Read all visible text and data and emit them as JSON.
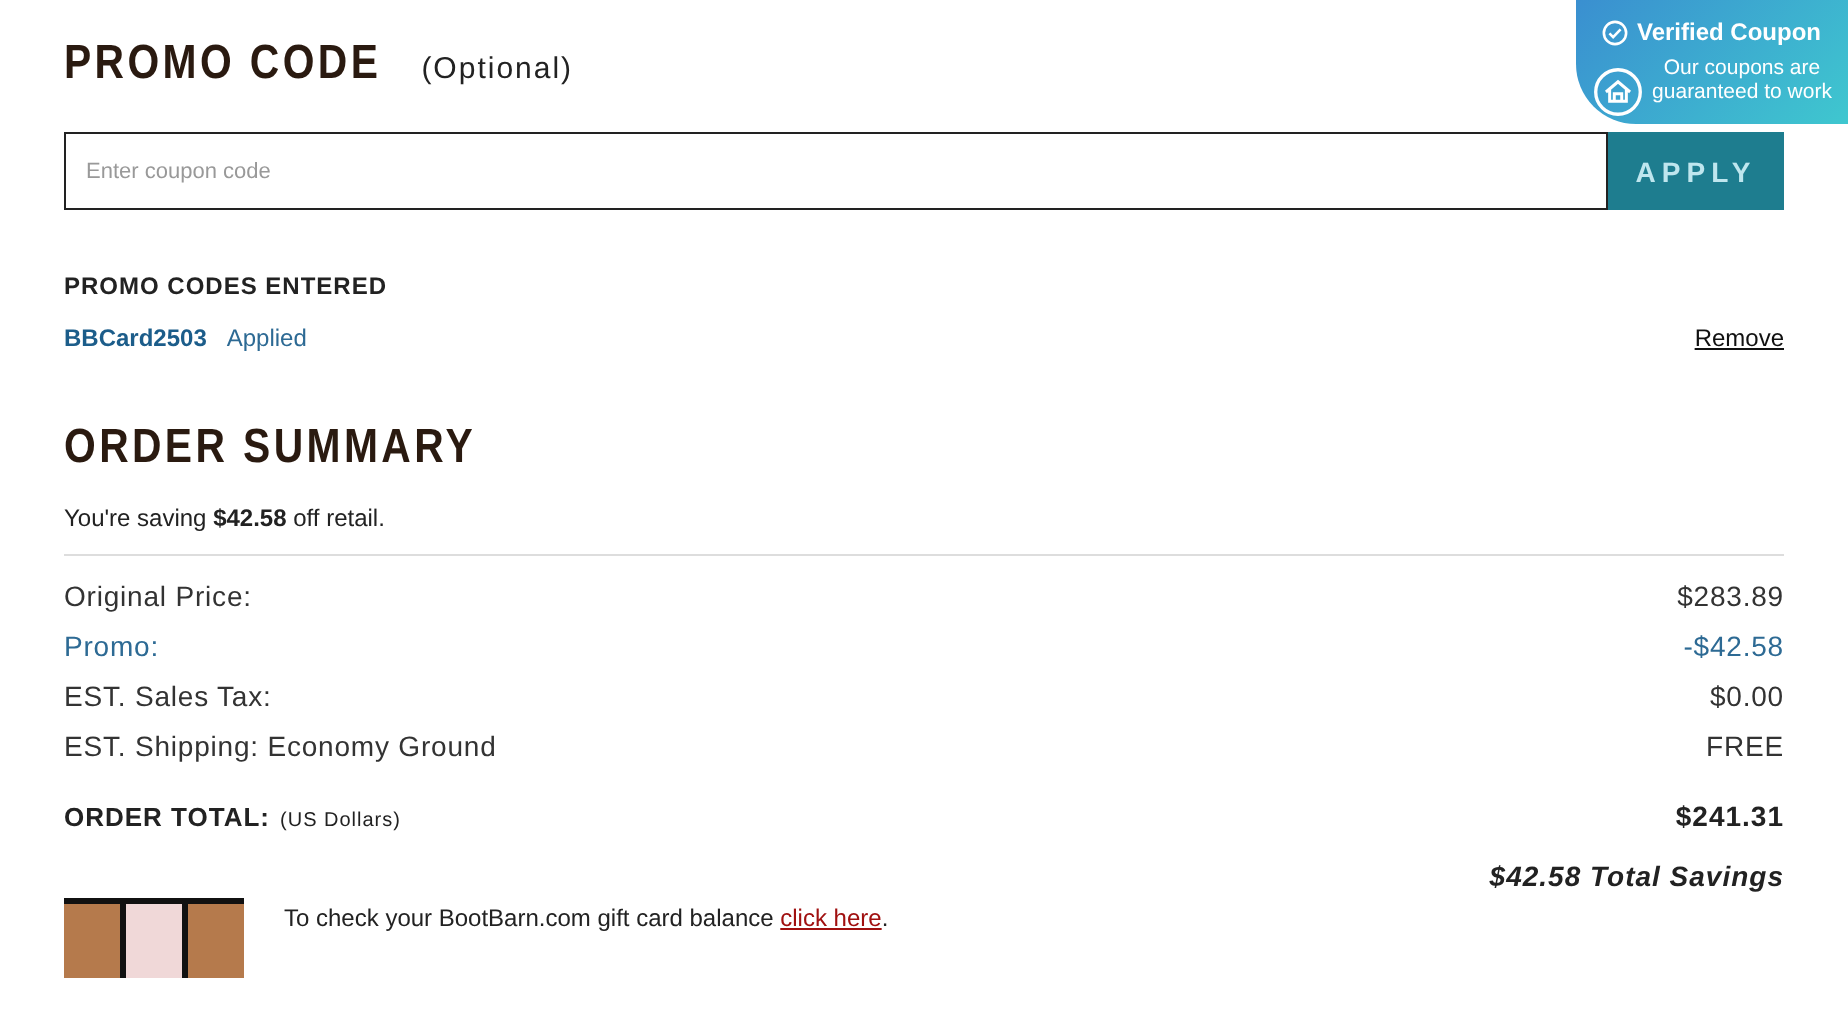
{
  "promo": {
    "title": "PROMO CODE",
    "subtitle": "(Optional)",
    "placeholder": "Enter coupon code",
    "apply_button": "APPLY"
  },
  "badge": {
    "title": "Verified Coupon",
    "text": "Our coupons are guaranteed to work"
  },
  "entered": {
    "title": "PROMO CODES ENTERED",
    "codes": [
      {
        "code": "BBCard2503",
        "status": "Applied",
        "action": "Remove"
      }
    ]
  },
  "summary": {
    "title": "ORDER SUMMARY",
    "saving_note": "You're saving **$42.58** off retail.",
    "rows": [
      {
        "kind": "normal",
        "label": "Original Price:",
        "value": "$283.89"
      },
      {
        "kind": "discount",
        "label": "Promo:",
        "value": "-$42.58"
      },
      {
        "kind": "normal",
        "label": "EST. Sales Tax:",
        "value": "$0.00"
      },
      {
        "kind": "normal",
        "label": "EST. Shipping: Economy Ground",
        "value": "FREE"
      }
    ],
    "total_label": "ORDER TOTAL:",
    "total_unit": "(US Dollars)",
    "total_value": "$241.31",
    "total_savings": "$42.58 Total Savings"
  },
  "gift_card": {
    "text": "To check your BootBarn.com gift card balance ",
    "link": "click here",
    "end": "."
  }
}
